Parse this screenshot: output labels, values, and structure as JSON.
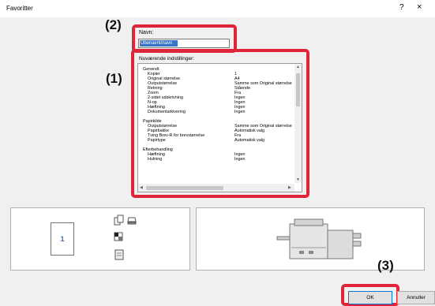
{
  "window": {
    "title": "Favoritter",
    "help_label": "?",
    "close_label": "×"
  },
  "callouts": {
    "name": "(2)",
    "settings": "(1)",
    "ok": "(3)"
  },
  "name_field": {
    "label": "Navn:",
    "value": "Ubenavnt/navn"
  },
  "settings": {
    "label": "Nuværende indstillinger:",
    "groups": [
      {
        "title": "Generelt",
        "rows": [
          {
            "key": "Kopier",
            "value": "1"
          },
          {
            "key": "Original størrelse",
            "value": "A4"
          },
          {
            "key": "Outputstørrelse",
            "value": "Samme som Original størrelse"
          },
          {
            "key": "Retning",
            "value": "Stående"
          },
          {
            "key": "Zoom",
            "value": "Fra"
          },
          {
            "key": "2-sidet udskrivning",
            "value": "Ingen"
          },
          {
            "key": "N-op",
            "value": "Ingen"
          },
          {
            "key": "Hæftning",
            "value": "Ingen"
          },
          {
            "key": "Dokumentarkivering",
            "value": "Ingen"
          }
        ]
      },
      {
        "title": "Papirkilde",
        "rows": [
          {
            "key": "Outputstørrelse",
            "value": "Samme som Original størrelse"
          },
          {
            "key": "Papirbakke",
            "value": "Automatisk valg"
          },
          {
            "key": "Tving Brev-R for brevstørrelse",
            "value": "Fra"
          },
          {
            "key": "Papirtype",
            "value": "Automatisk valg"
          }
        ]
      },
      {
        "title": "Efterbehandling",
        "rows": [
          {
            "key": "Hæftning",
            "value": "Ingen"
          },
          {
            "key": "Hulning",
            "value": "Ingen"
          }
        ]
      }
    ]
  },
  "preview": {
    "page_number": "1"
  },
  "buttons": {
    "ok": "OK",
    "cancel": "Annuller"
  },
  "colors": {
    "highlight": "#e0243a",
    "selection": "#3874c4"
  }
}
